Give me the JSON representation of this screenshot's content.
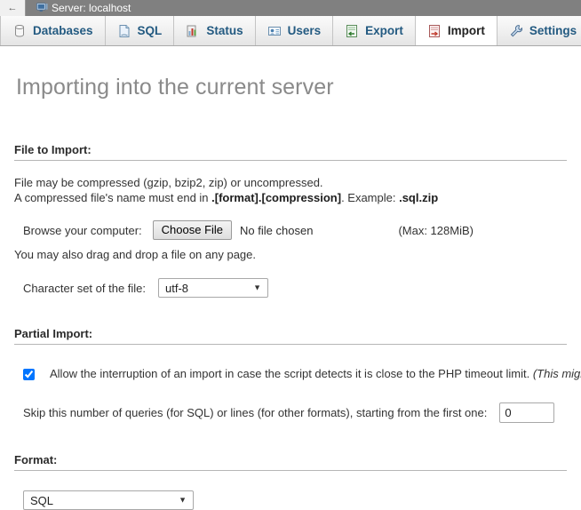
{
  "titlebar": {
    "back_label": "←",
    "server_text": "Server: localhost",
    "monitor_icon": "monitor-icon"
  },
  "tabs": [
    {
      "label": "Databases",
      "icon": "database-icon",
      "active": false
    },
    {
      "label": "SQL",
      "icon": "sql-document-icon",
      "active": false
    },
    {
      "label": "Status",
      "icon": "status-chart-icon",
      "active": false
    },
    {
      "label": "Users",
      "icon": "users-card-icon",
      "active": false
    },
    {
      "label": "Export",
      "icon": "export-icon",
      "active": false
    },
    {
      "label": "Import",
      "icon": "import-icon",
      "active": true
    },
    {
      "label": "Settings",
      "icon": "wrench-icon",
      "active": false
    }
  ],
  "page": {
    "title": "Importing into the current server"
  },
  "file_section": {
    "heading": "File to Import:",
    "desc_line1": "File may be compressed (gzip, bzip2, zip) or uncompressed.",
    "desc_line2_pre": "A compressed file's name must end in ",
    "desc_line2_bold": ".[format].[compression]",
    "desc_line2_mid": ". Example: ",
    "desc_line2_bold2": ".sql.zip",
    "browse_label": "Browse your computer:",
    "choose_file_label": "Choose File",
    "no_file_text": "No file chosen",
    "max_size": "(Max: 128MiB)",
    "drag_note": "You may also drag and drop a file on any page.",
    "charset_label": "Character set of the file:",
    "charset_value": "utf-8"
  },
  "partial_section": {
    "heading": "Partial Import:",
    "allow_interrupt_checked": true,
    "allow_interrupt_label": "Allow the interruption of an import in case the script detects it is close to the PHP timeout limit. ",
    "allow_interrupt_note": "(This migh",
    "skip_label": "Skip this number of queries (for SQL) or lines (for other formats), starting from the first one:",
    "skip_value": "0"
  },
  "format_section": {
    "heading": "Format:",
    "format_value": "SQL"
  }
}
